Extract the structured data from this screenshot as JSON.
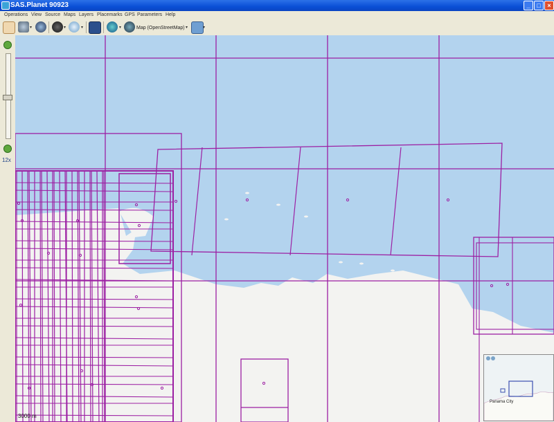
{
  "window": {
    "title": "SAS.Planet 90923"
  },
  "menu": [
    "Operations",
    "View",
    "Source",
    "Maps",
    "Layers",
    "Placemarks",
    "GPS",
    "Parameters",
    "Help"
  ],
  "toolbar": {
    "map_label": "Map (OpenStreetMap)",
    "icons": [
      "hand-pan-icon",
      "globe-settings-icon",
      "satellite-icon",
      "circle-dark-icon",
      "magnifier-icon",
      "screen-icon",
      "layers-globe-icon",
      "osm-icon",
      "map-type-icon"
    ]
  },
  "sidebar": {
    "zoom_level": "12x"
  },
  "map": {
    "scale_label": "3000 m",
    "minimap_label": "Panama City",
    "water_color": "#b3d3ee",
    "land_color": "#f3f3f1",
    "tile_line_color": "#9c1fa3"
  }
}
